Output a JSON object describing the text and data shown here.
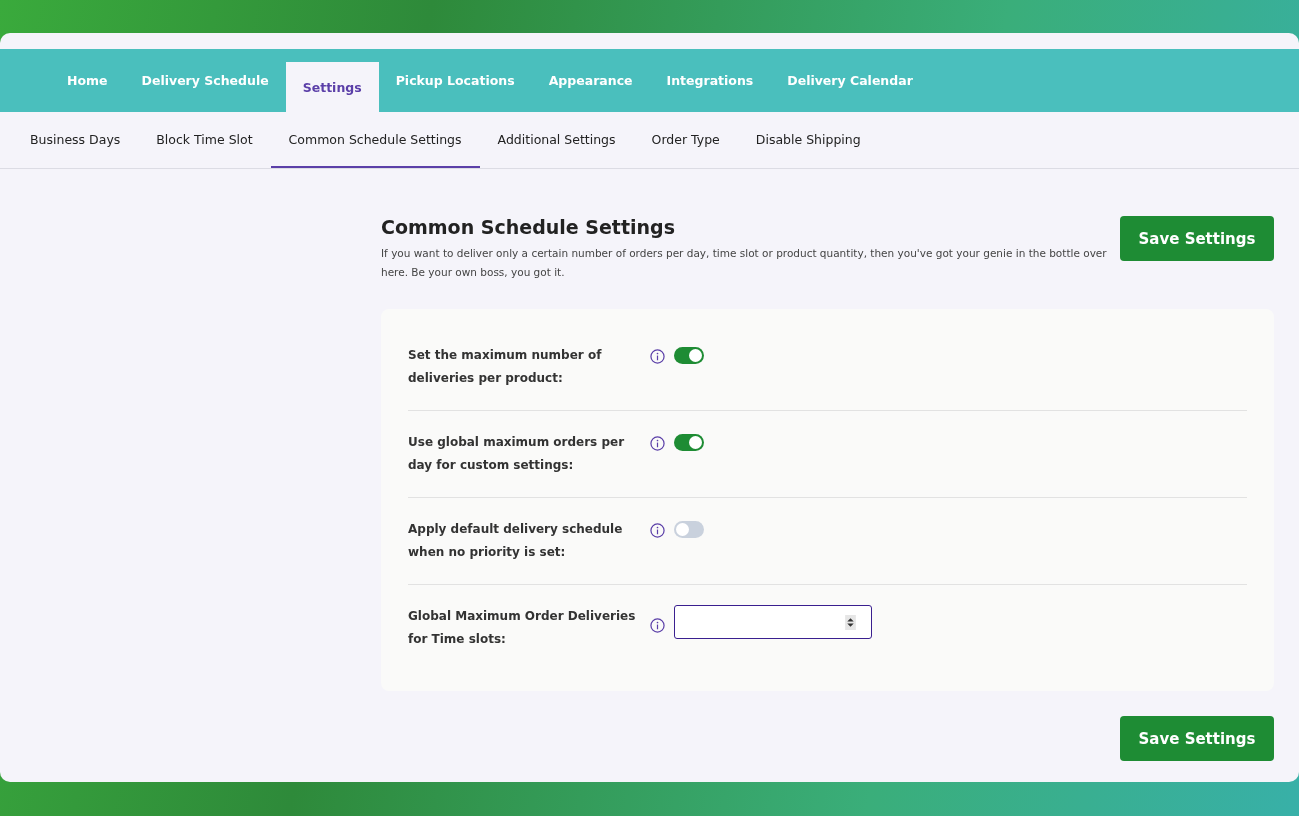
{
  "nav_tabs": [
    {
      "label": "Home",
      "selected": false
    },
    {
      "label": "Delivery Schedule",
      "selected": false
    },
    {
      "label": "Settings",
      "selected": true
    },
    {
      "label": "Pickup Locations",
      "selected": false
    },
    {
      "label": "Appearance",
      "selected": false
    },
    {
      "label": "Integrations",
      "selected": false
    },
    {
      "label": "Delivery Calendar",
      "selected": false
    }
  ],
  "sub_tabs": [
    {
      "label": "Business Days",
      "selected": false
    },
    {
      "label": "Block Time Slot",
      "selected": false
    },
    {
      "label": "Common Schedule Settings",
      "selected": true
    },
    {
      "label": "Additional Settings",
      "selected": false
    },
    {
      "label": "Order Type",
      "selected": false
    },
    {
      "label": "Disable Shipping",
      "selected": false
    }
  ],
  "header": {
    "title": "Common Schedule Settings",
    "description": "If you want to deliver only a certain number of orders per day, time slot or product quantity, then you've got your genie in the bottle over here. Be your own boss, you got it.",
    "save_button": "Save Settings"
  },
  "settings": [
    {
      "kind": "toggle",
      "label": "Set the maximum number of deliveries per product:",
      "on": true
    },
    {
      "kind": "toggle",
      "label": "Use global maximum orders per day for custom settings:",
      "on": true
    },
    {
      "kind": "toggle",
      "label": "Apply default delivery schedule when no priority is set:",
      "on": false
    },
    {
      "kind": "number",
      "label": "Global Maximum Order Deliveries for Time slots:"
    }
  ],
  "footer": {
    "save_button": "Save Settings"
  }
}
